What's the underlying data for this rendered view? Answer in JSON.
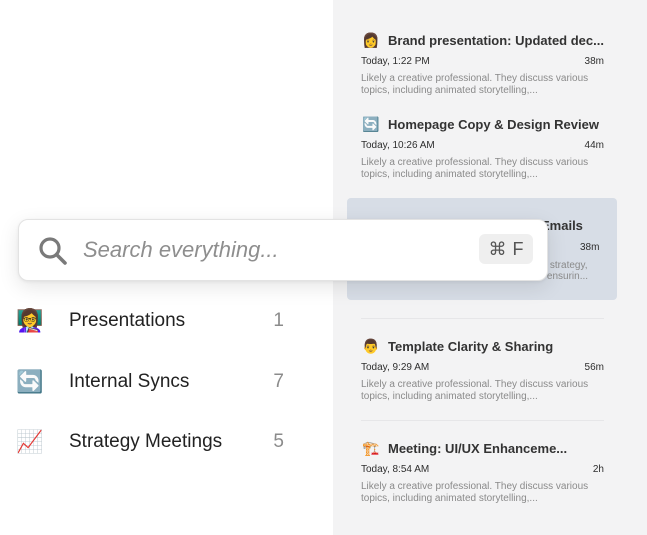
{
  "search": {
    "placeholder": "Search everything...",
    "shortcut_symbol": "⌘",
    "shortcut_key": "F"
  },
  "categories": [
    {
      "icon": "teacher-presenter-icon",
      "label": "Presentations",
      "count": "1"
    },
    {
      "icon": "sync-arrows-icon",
      "label": "Internal Syncs",
      "count": "7"
    },
    {
      "icon": "trend-chart-icon",
      "label": "Strategy Meetings",
      "count": "5"
    }
  ],
  "meetings": [
    {
      "icon": "woman-avatar-icon",
      "title": "Brand presentation: Updated dec...",
      "time": "Today, 1:22 PM",
      "duration": "38m",
      "desc": "Likely a creative professional. They discuss various topics, including animated storytelling,..."
    },
    {
      "icon": "sync-arrows-icon",
      "title": "Homepage Copy & Design Review",
      "time": "Today, 10:26 AM",
      "duration": "44m",
      "desc": "Likely a creative professional. They discuss various topics, including animated storytelling,..."
    },
    {
      "icon": "man-avatar-icon",
      "title": "Template Clarity & Sharing",
      "time": "Today, 9:29 AM",
      "duration": "56m",
      "desc": "Likely a creative professional. They discuss various topics, including animated storytelling,..."
    },
    {
      "icon": "construction-crane-icon",
      "title": "Meeting: UI/UX Enhanceme...",
      "time": "Today, 8:54 AM",
      "duration": "2h",
      "desc": "Likely a creative professional. They discuss various topics, including animated storytelling,..."
    }
  ],
  "selected_meeting": {
    "title_fragment": "Emails",
    "duration": "38m",
    "desc_line1": "on strategy,",
    "desc_line2": "nd ensurin..."
  },
  "colors": {
    "sidebar_bg": "#f3f3f4",
    "selected_bg": "#d7dde6"
  }
}
